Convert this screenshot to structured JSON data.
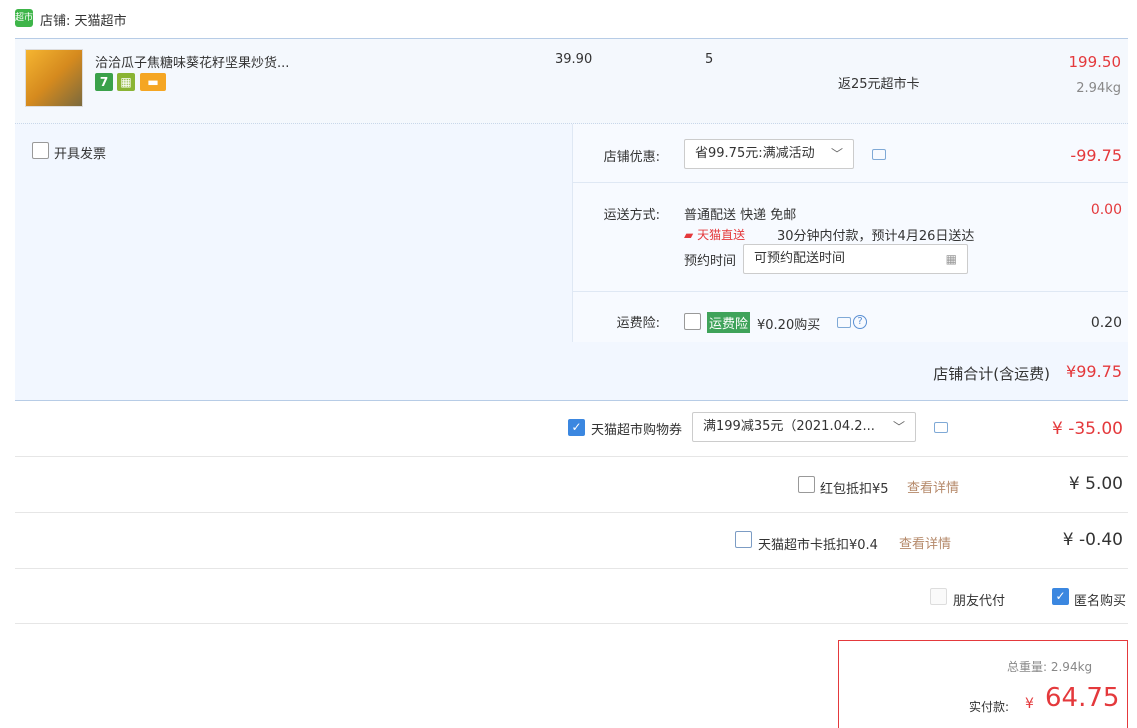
{
  "shop": {
    "logo_text": "超市",
    "name": "店铺: 天猫超市"
  },
  "product": {
    "title": "洽洽瓜子焦糖味葵花籽坚果炒货...",
    "badges": [
      "7",
      "▦",
      "▬"
    ],
    "unit_price": "39.90",
    "quantity": "5",
    "cashback": "返25元超市卡",
    "subtotal": "199.50",
    "weight": "2.94kg"
  },
  "invoice": {
    "label": "开具发票"
  },
  "shop_discount": {
    "label": "店铺优惠:",
    "selected": "省99.75元:满减活动",
    "amount": "-99.75"
  },
  "shipping": {
    "label": "运送方式:",
    "method": "普通配送 快递 免邮",
    "direct_tag": "天猫直送",
    "direct_text": "30分钟内付款，预计4月26日送达",
    "schedule_label": "预约时间",
    "schedule_placeholder": "可预约配送时间",
    "amount": "0.00"
  },
  "insurance": {
    "label": "运费险:",
    "tag": "运费险",
    "text": "¥0.20购买",
    "help": "?",
    "amount": "0.20"
  },
  "shop_total": {
    "label": "店铺合计(含运费)",
    "amount": "¥99.75"
  },
  "coupon": {
    "label": "天猫超市购物券",
    "selected": "满199减35元（2021.04.2...",
    "amount": "¥ -35.00"
  },
  "redpacket": {
    "label": "红包抵扣¥5",
    "link": "查看详情",
    "amount": "¥ 5.00"
  },
  "supercard": {
    "label": "天猫超市卡抵扣¥0.4",
    "link": "查看详情",
    "amount": "¥ -0.40"
  },
  "options": {
    "friend_pay": "朋友代付",
    "anonymous": "匿名购买"
  },
  "summary": {
    "weight_label": "总重量: 2.94kg",
    "pay_label": "实付款:",
    "currency": "¥",
    "pay_amount": "64.75"
  },
  "colors": {
    "price_red": "#e4393c",
    "border_blue": "#b7cce6",
    "check_blue": "#3b87e0",
    "tmall_green": "#3fa35a"
  }
}
